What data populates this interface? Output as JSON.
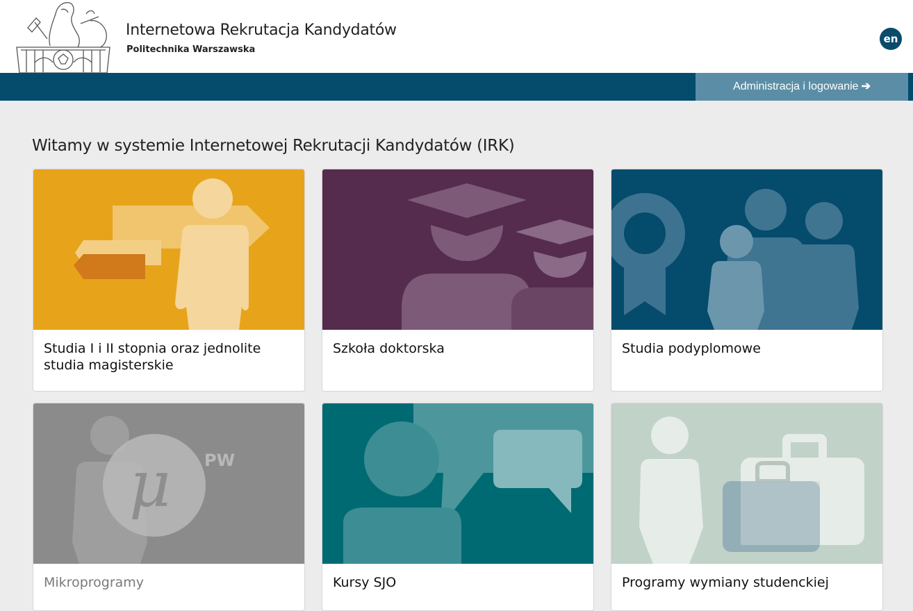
{
  "header": {
    "title": "Internetowa Rekrutacja Kandydatów",
    "subtitle": "Politechnika Warszawska",
    "language_toggle": "en"
  },
  "navbar": {
    "login_label": "Administracja i logowanie",
    "login_arrow": "➔"
  },
  "main": {
    "welcome": "Witamy w systemie Internetowej Rekrutacji Kandydatów (IRK)",
    "cards": [
      {
        "label": "Studia I i II stopnia oraz jednolite studia magisterskie",
        "color": "#e7a41a",
        "icon": "signpost-person-illustration"
      },
      {
        "label": "Szkoła doktorska",
        "color": "#552b4e",
        "icon": "graduates-illustration"
      },
      {
        "label": "Studia podyplomowe",
        "color": "#044b6c",
        "icon": "family-rosette-illustration"
      },
      {
        "label": "Mikroprogramy",
        "color": "#8b8b8b",
        "icon": "micro-pw-illustration",
        "badge": "PW",
        "glyph": "μ"
      },
      {
        "label": "Kursy SJO",
        "color": "#006a73",
        "icon": "speech-bubbles-illustration"
      },
      {
        "label": "Programy wymiany studenckiej",
        "color": "#c1d2c9",
        "icon": "traveler-suitcase-illustration"
      }
    ]
  },
  "colors": {
    "brand_dark": "#044b6c",
    "login_button": "#5b8ea6",
    "background": "#ececec"
  }
}
